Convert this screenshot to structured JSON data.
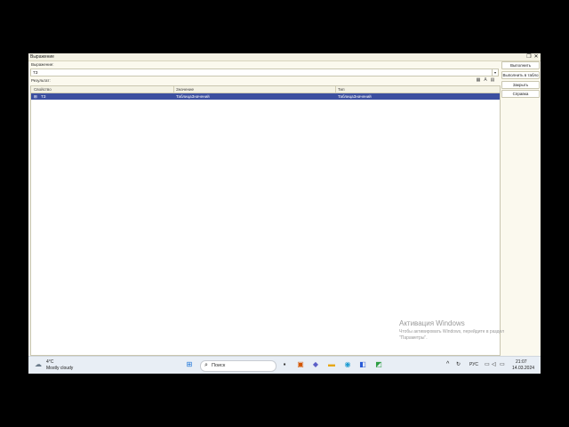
{
  "window": {
    "title": "Выражение",
    "restore_icon": "restore-icon",
    "close_icon": "close-icon"
  },
  "expression": {
    "label": "Выражение:",
    "value": "ТЗ"
  },
  "result": {
    "label": "Результат:"
  },
  "table": {
    "columns": [
      "Свойство",
      "Значение",
      "Тип"
    ],
    "rows": [
      {
        "property": "ТЗ",
        "value": "ТаблицаЗначений",
        "type": "ТаблицаЗначений"
      }
    ]
  },
  "buttons": {
    "execute": "Выполнить",
    "execute_table": "Выполнить в табло",
    "close": "Закрыть",
    "help": "Справка"
  },
  "watermark": {
    "title": "Активация Windows",
    "line1": "Чтобы активировать Windows, перейдите в раздел",
    "line2": "\"Параметры\"."
  },
  "taskbar": {
    "weather_temp": "4°C",
    "weather_desc": "Mostly cloudy",
    "search_label": "Поиск",
    "lang": "РУС",
    "time": "21:07",
    "date": "14.03.2024"
  }
}
